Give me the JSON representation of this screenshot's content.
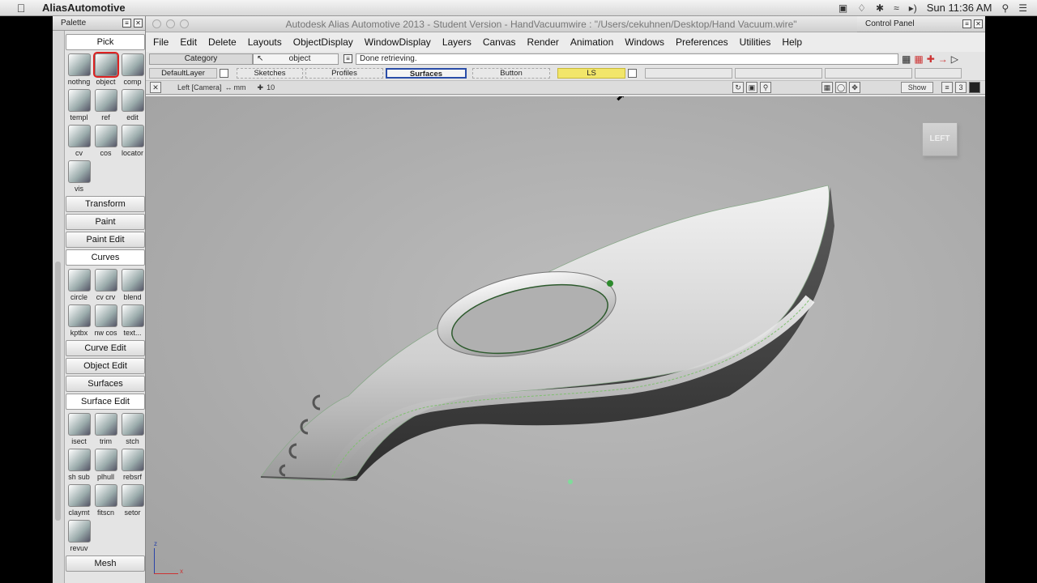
{
  "mac_menubar": {
    "app_name": "AliasAutomotive",
    "clock": "Sun 11:36 AM"
  },
  "palette": {
    "title": "Palette",
    "sections": {
      "pick": "Pick",
      "transform": "Transform",
      "paint": "Paint",
      "paint_edit": "Paint Edit",
      "curves": "Curves",
      "curve_edit": "Curve Edit",
      "object_edit": "Object Edit",
      "surfaces": "Surfaces",
      "surface_edit": "Surface Edit",
      "mesh": "Mesh"
    },
    "pick_tools": [
      "nothng",
      "object",
      "comp",
      "templ",
      "ref",
      "edit",
      "cv",
      "cos",
      "locator",
      "vis"
    ],
    "curve_tools": [
      "circle",
      "cv crv",
      "blend",
      "kptbx",
      "nw cos",
      "text..."
    ],
    "surface_edit_tools": [
      "isect",
      "trim",
      "stch",
      "sh sub",
      "plhull",
      "rebsrf",
      "claymt",
      "fitscn",
      "setor",
      "revuv"
    ]
  },
  "window": {
    "title": "Autodesk Alias Automotive 2013 - Student Version - HandVacuumwire : \"/Users/cekuhnen/Desktop/Hand Vacuum.wire\"",
    "control_panel": "Control Panel"
  },
  "menu": [
    "File",
    "Edit",
    "Delete",
    "Layouts",
    "ObjectDisplay",
    "WindowDisplay",
    "Layers",
    "Canvas",
    "Render",
    "Animation",
    "Windows",
    "Preferences",
    "Utilities",
    "Help"
  ],
  "toolbar": {
    "category_label": "Category",
    "object_label": "object",
    "status_text": "Done retrieving."
  },
  "layers": {
    "default": "DefaultLayer",
    "sketches": "Sketches",
    "profiles": "Profiles",
    "surfaces": "Surfaces",
    "button": "Button",
    "ls": "LS"
  },
  "view": {
    "label": "Left [Camera]",
    "units": "mm",
    "grid": "10",
    "show_label": "Show",
    "layout_number": "3",
    "view_cube": "LEFT",
    "axis_z": "z",
    "axis_x": "x"
  },
  "colors": {
    "ls_layer": "#f2e66a",
    "surfaces_layer_border": "#2a4da8"
  }
}
